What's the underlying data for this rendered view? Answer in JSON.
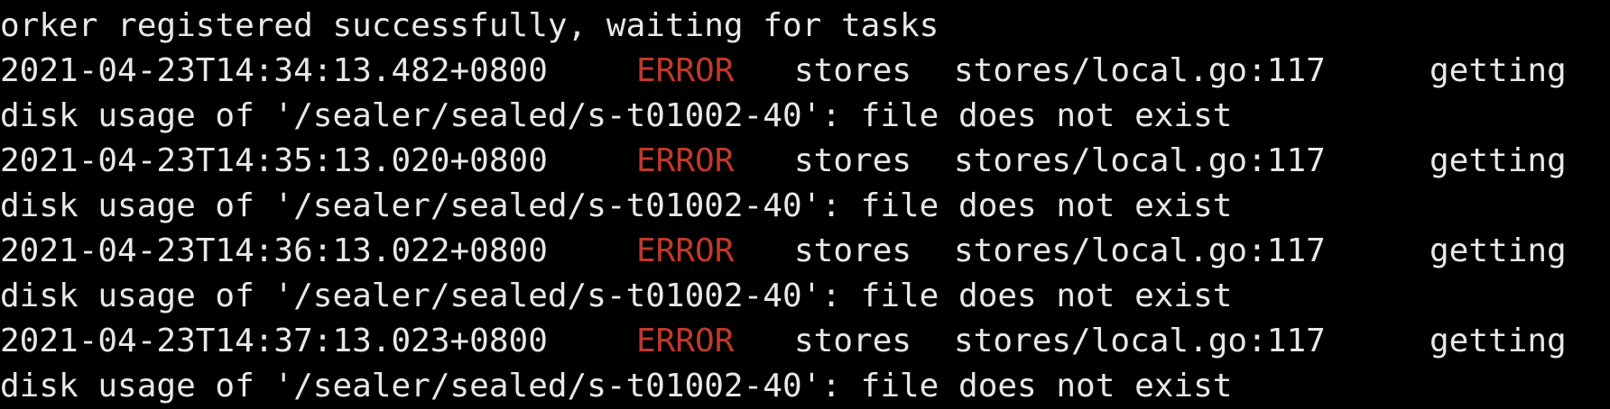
{
  "terminal": {
    "lines": [
      {
        "text": "orker registered successfully, waiting for tasks"
      },
      {
        "timestamp": "2021-04-23T14:34:13.482+0800",
        "level": "ERROR",
        "module": "stores",
        "source": "stores/local.go:117",
        "message": "getting"
      },
      {
        "text": "disk usage of '/sealer/sealed/s-t01002-40': file does not exist"
      },
      {
        "timestamp": "2021-04-23T14:35:13.020+0800",
        "level": "ERROR",
        "module": "stores",
        "source": "stores/local.go:117",
        "message": "getting"
      },
      {
        "text": "disk usage of '/sealer/sealed/s-t01002-40': file does not exist"
      },
      {
        "timestamp": "2021-04-23T14:36:13.022+0800",
        "level": "ERROR",
        "module": "stores",
        "source": "stores/local.go:117",
        "message": "getting"
      },
      {
        "text": "disk usage of '/sealer/sealed/s-t01002-40': file does not exist"
      },
      {
        "timestamp": "2021-04-23T14:37:13.023+0800",
        "level": "ERROR",
        "module": "stores",
        "source": "stores/local.go:117",
        "message": "getting"
      },
      {
        "text": "disk usage of '/sealer/sealed/s-t01002-40': file does not exist"
      }
    ]
  },
  "colors": {
    "background": "#000000",
    "text": "#e8e8e8",
    "error": "#c0392b"
  }
}
